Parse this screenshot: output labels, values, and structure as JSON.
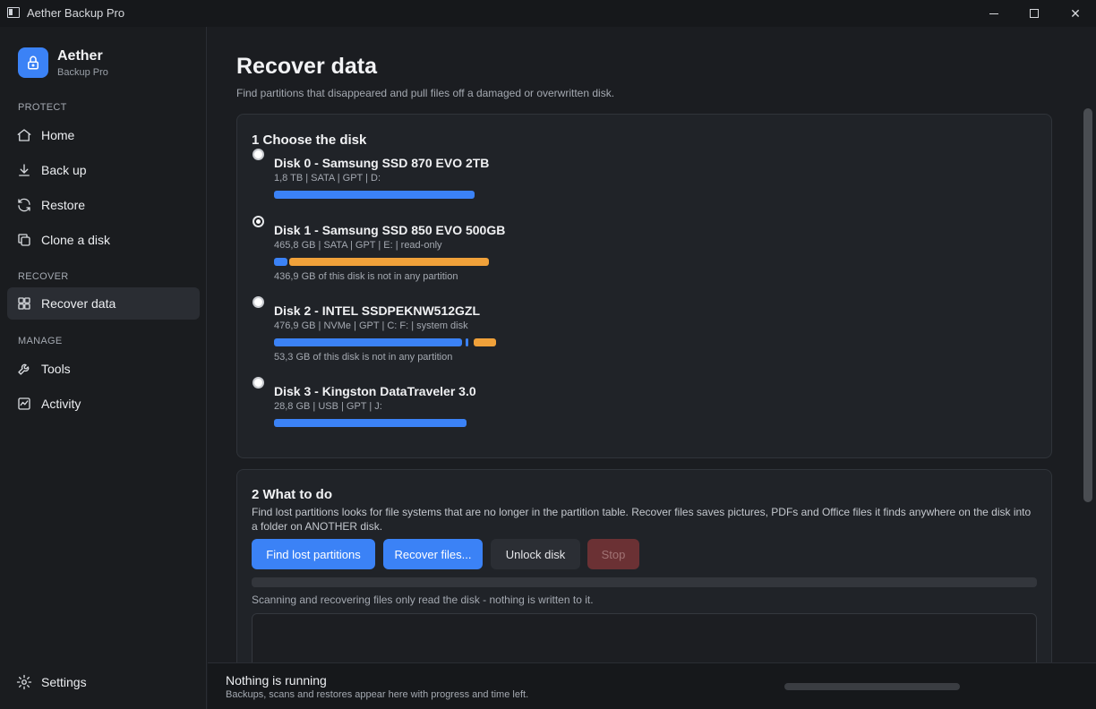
{
  "window": {
    "title": "Aether Backup Pro",
    "minimize_glyph": "",
    "maximize_glyph": "",
    "close_glyph": "✕"
  },
  "brand": {
    "name": "Aether",
    "subtitle": "Backup Pro",
    "accent": "#3b82f6"
  },
  "sidebar": {
    "sections": [
      {
        "label": "PROTECT"
      },
      {
        "label": "RECOVER"
      },
      {
        "label": "MANAGE"
      }
    ],
    "items": [
      {
        "label": "Home",
        "icon": "home-icon"
      },
      {
        "label": "Back up",
        "icon": "download-icon"
      },
      {
        "label": "Restore",
        "icon": "refresh-icon"
      },
      {
        "label": "Clone a disk",
        "icon": "copy-icon"
      },
      {
        "label": "Recover data",
        "icon": "puzzle-icon",
        "active": true
      },
      {
        "label": "Tools",
        "icon": "wrench-icon"
      },
      {
        "label": "Activity",
        "icon": "activity-icon"
      }
    ],
    "settings_label": "Settings"
  },
  "page": {
    "title": "Recover data",
    "subtitle": "Find partitions that disappeared and pull files off a damaged or overwritten disk."
  },
  "step1": {
    "title": "1  Choose the disk",
    "disks": [
      {
        "name": "Disk 0 - Samsung SSD 870 EVO 2TB",
        "meta": "1,8 TB  |  SATA  |  GPT  |  D:",
        "note": "",
        "selected": false
      },
      {
        "name": "Disk 1 - Samsung SSD 850 EVO 500GB",
        "meta": "465,8 GB  |  SATA  |  GPT  |  E:  |  read-only",
        "note": "436,9 GB of this disk is not in any partition",
        "selected": true
      },
      {
        "name": "Disk 2 - INTEL SSDPEKNW512GZL",
        "meta": "476,9 GB  |  NVMe  |  GPT  |  C: F:  |  system disk",
        "note": "53,3 GB of this disk is not in any partition",
        "selected": false
      },
      {
        "name": "Disk 3 - Kingston DataTraveler 3.0",
        "meta": "28,8 GB  |  USB  |  GPT  |  J:",
        "note": "",
        "selected": false
      }
    ],
    "colors": {
      "partition": "#3b82f6",
      "unallocated": "#f0a13a"
    }
  },
  "step2": {
    "title": "2  What to do",
    "description": "Find lost partitions looks for file systems that are no longer in the partition table. Recover files saves pictures, PDFs and Office files it finds anywhere on the disk into a folder on ANOTHER disk.",
    "buttons": {
      "find": "Find lost partitions",
      "recover": "Recover files...",
      "unlock": "Unlock disk",
      "stop": "Stop"
    },
    "progress": 0,
    "safety_note": "Scanning and recovering files only read the disk - nothing is written to it."
  },
  "status": {
    "title": "Nothing is running",
    "subtitle": "Backups, scans and restores appear here with progress and time left.",
    "progress": 0
  }
}
